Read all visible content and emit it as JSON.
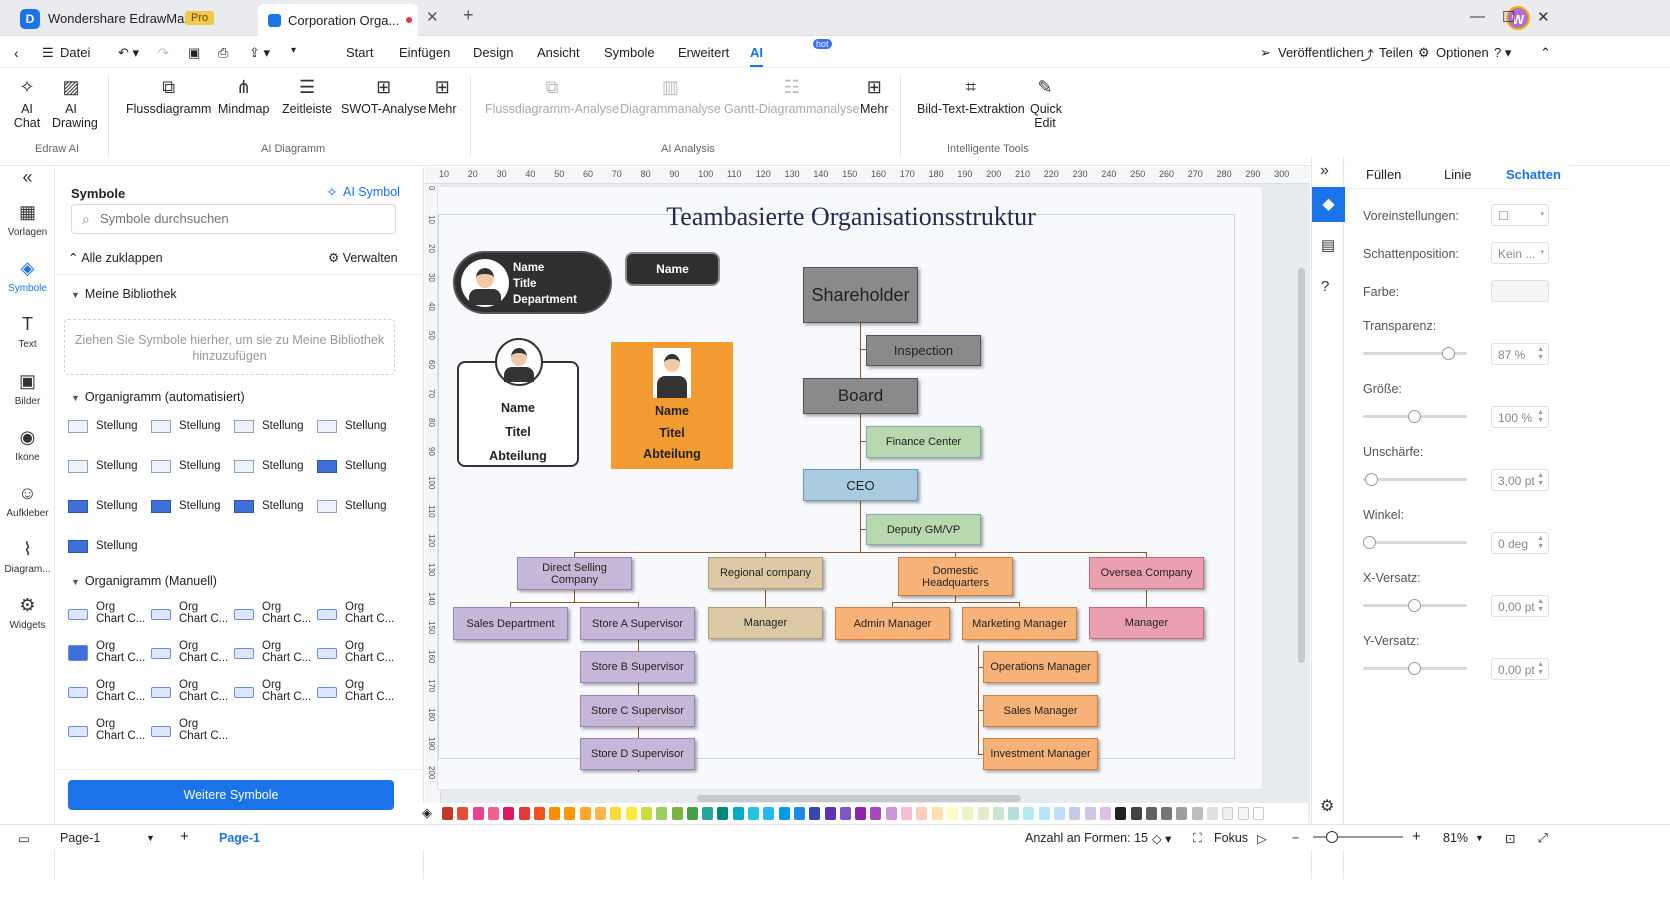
{
  "titlebar": {
    "app_name": "Wondershare EdrawMax",
    "pro_badge": "Pro",
    "doc_tab": "Corporation Orga...",
    "avatar": "W"
  },
  "menubar": {
    "items": [
      "Datei",
      "Start",
      "Einfügen",
      "Design",
      "Ansicht",
      "Symbole",
      "Erweitert",
      "AI"
    ],
    "hot_badge": "hot",
    "right": [
      "Veröffentlichen",
      "Teilen",
      "Optionen"
    ]
  },
  "ribbon": {
    "edraw_ai": {
      "group": "Edraw AI",
      "ai_chat": "AI Chat",
      "ai_drawing": "AI Drawing"
    },
    "ai_diagram": {
      "group": "AI Diagramm",
      "items": [
        "Flussdiagramm",
        "Mindmap",
        "Zeitleiste",
        "SWOT-Analyse",
        "Mehr"
      ]
    },
    "ai_analysis": {
      "group": "AI Analysis",
      "items": [
        "Flussdiagramm-Analyse",
        "Diagrammanalyse",
        "Gantt-Diagrammanalyse",
        "Mehr"
      ]
    },
    "tools": {
      "group": "Intelligente Tools",
      "items": [
        "Bild-Text-Extraktion",
        "Quick Edit"
      ]
    }
  },
  "leftbar": [
    "Vorlagen",
    "Symbole",
    "Text",
    "Bilder",
    "Ikone",
    "Aufkleber",
    "Diagram...",
    "Widgets"
  ],
  "symbols": {
    "title": "Symbole",
    "ai_symbol": "AI Symbol",
    "search_placeholder": "Symbole durchsuchen",
    "collapse_all": "Alle zuklappen",
    "manage": "Verwalten",
    "my_library": "Meine Bibliothek",
    "drop_hint": "Ziehen Sie Symbole hierher, um sie zu Meine Bibliothek hinzuzufügen",
    "org_auto": "Organigramm (automatisiert)",
    "auto_items": [
      "Stellung",
      "Stellung",
      "Stellung",
      "Stellung",
      "Stellung",
      "Stellung",
      "Stellung",
      "Stellung",
      "Stellung",
      "Stellung",
      "Stellung",
      "Stellung",
      "Stellung"
    ],
    "org_manual": "Organigramm (Manuell)",
    "manual_line1": "Org",
    "manual_line2": "Chart C...",
    "more_button": "Weitere Symbole"
  },
  "canvas": {
    "title": "Teambasierte Organisationsstruktur",
    "card1": {
      "name": "Name",
      "title": "Title",
      "dept": "Department"
    },
    "pill": "Name",
    "card2": {
      "name": "Name",
      "title": "Titel",
      "dept": "Abteilung"
    },
    "card3": {
      "name": "Name",
      "title": "Titel",
      "dept": "Abteilung"
    },
    "nodes": {
      "shareholder": "Shareholder",
      "inspection": "Inspection",
      "board": "Board",
      "finance": "Finance Center",
      "ceo": "CEO",
      "deputy": "Deputy GM/VP",
      "direct": "Direct Selling Company",
      "regional": "Regional company",
      "domestic": "Domestic Headquarters",
      "oversea": "Oversea Company",
      "sales_dept": "Sales Department",
      "store_a": "Store A Supervisor",
      "store_b": "Store B Supervisor",
      "store_c": "Store C Supervisor",
      "store_d": "Store D Supervisor",
      "reg_manager": "Manager",
      "admin": "Admin Manager",
      "marketing": "Marketing Manager",
      "ops": "Operations Manager",
      "sales_mgr": "Sales Manager",
      "invest": "Investment Manager",
      "ov_manager": "Manager"
    },
    "hruler": [
      "10",
      "20",
      "30",
      "40",
      "50",
      "60",
      "70",
      "80",
      "90",
      "100",
      "110",
      "120",
      "130",
      "140",
      "150",
      "160",
      "170",
      "180",
      "190",
      "200",
      "210",
      "220",
      "230",
      "240",
      "250",
      "260",
      "270",
      "280",
      "290",
      "300"
    ],
    "vruler": [
      "0",
      "10",
      "20",
      "30",
      "40",
      "50",
      "60",
      "70",
      "80",
      "90",
      "100",
      "110",
      "120",
      "130",
      "140",
      "150",
      "160",
      "170",
      "180",
      "190",
      "200"
    ]
  },
  "rightpanel": {
    "tabs": [
      "Füllen",
      "Linie",
      "Schatten"
    ],
    "presets": "Voreinstellungen:",
    "shadow_pos": "Schattenposition:",
    "shadow_pos_val": "Kein ...",
    "color": "Farbe:",
    "transparency": "Transparenz:",
    "transparency_val": "87 %",
    "size": "Größe:",
    "size_val": "100 %",
    "blur": "Unschärfe:",
    "blur_val": "3,00 pt",
    "angle": "Winkel:",
    "angle_val": "0 deg",
    "xoff": "X-Versatz:",
    "xoff_val": "0,00 pt",
    "yoff": "Y-Versatz:",
    "yoff_val": "0,00 pt"
  },
  "status": {
    "page_select": "Page-1",
    "page_tab": "Page-1",
    "shape_count": "Anzahl an Formen: 15",
    "focus": "Fokus",
    "zoom": "81%"
  },
  "colors": {
    "accent": "#1a73e8",
    "palette": [
      "#c0392b",
      "#e74c3c",
      "#e84393",
      "#f06292",
      "#d81b60",
      "#e53935",
      "#f4511e",
      "#fb8c00",
      "#ff9800",
      "#ffa726",
      "#ffb74d",
      "#fdd835",
      "#ffeb3b",
      "#cddc39",
      "#9ccc65",
      "#7cb342",
      "#43a047",
      "#26a69a",
      "#00897b",
      "#00acc1",
      "#26c6da",
      "#29b6f6",
      "#039be5",
      "#1e88e5",
      "#3949ab",
      "#5e35b1",
      "#7e57c2",
      "#8e24aa",
      "#ab47bc",
      "#ce93d8",
      "#f8bbd0",
      "#ffccbc",
      "#ffe0b2",
      "#fff9c4",
      "#f0f4c3",
      "#dcedc8",
      "#c8e6c9",
      "#b2dfdb",
      "#b2ebf2",
      "#b3e5fc",
      "#bbdefb",
      "#c5cae9",
      "#d1c4e9",
      "#e1bee7",
      "#212121",
      "#424242",
      "#616161",
      "#757575",
      "#9e9e9e",
      "#bdbdbd",
      "#e0e0e0",
      "#eeeeee",
      "#f5f5f5",
      "#ffffff"
    ]
  }
}
